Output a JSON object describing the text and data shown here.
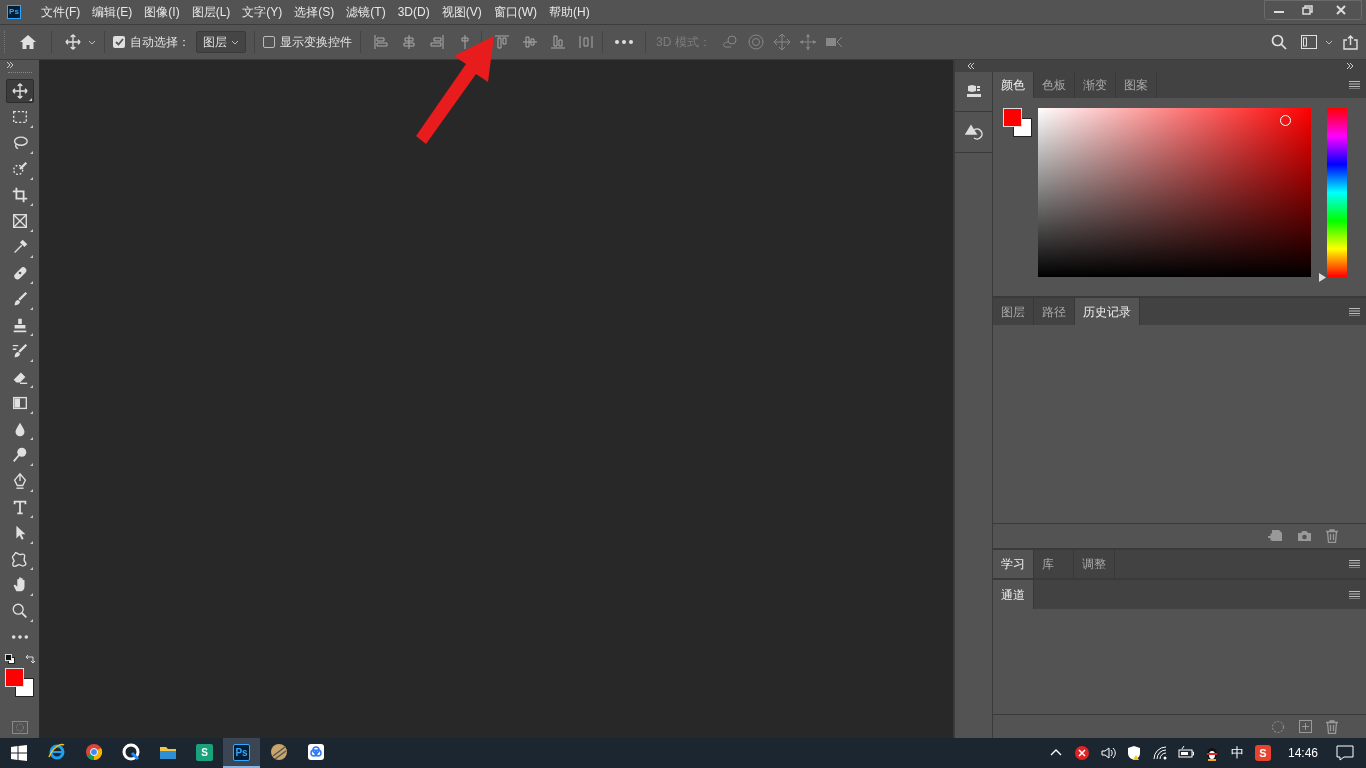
{
  "app_logo": "Ps",
  "menu": [
    "文件(F)",
    "编辑(E)",
    "图像(I)",
    "图层(L)",
    "文字(Y)",
    "选择(S)",
    "滤镜(T)",
    "3D(D)",
    "视图(V)",
    "窗口(W)",
    "帮助(H)"
  ],
  "options_bar": {
    "auto_select": {
      "label": "自动选择：",
      "checked": true
    },
    "target": {
      "value": "图层"
    },
    "show_transform": {
      "label": "显示变换控件",
      "checked": false
    },
    "mode_label": "3D 模式："
  },
  "tools": [
    {
      "kind": "move",
      "selected": true
    },
    {
      "kind": "marquee",
      "selected": false
    },
    {
      "kind": "lasso",
      "selected": false
    },
    {
      "kind": "quick",
      "selected": false
    },
    {
      "kind": "crop",
      "selected": false
    },
    {
      "kind": "frame",
      "selected": false
    },
    {
      "kind": "eyedropper",
      "selected": false
    },
    {
      "kind": "healing",
      "selected": false
    },
    {
      "kind": "brush",
      "selected": false
    },
    {
      "kind": "stamp",
      "selected": false
    },
    {
      "kind": "history",
      "selected": false
    },
    {
      "kind": "eraser",
      "selected": false
    },
    {
      "kind": "gradient",
      "selected": false
    },
    {
      "kind": "blur",
      "selected": false
    },
    {
      "kind": "dodge",
      "selected": false
    },
    {
      "kind": "pen",
      "selected": false
    },
    {
      "kind": "type",
      "selected": false
    },
    {
      "kind": "pathselect",
      "selected": false
    },
    {
      "kind": "shape",
      "selected": false
    },
    {
      "kind": "hand",
      "selected": false
    },
    {
      "kind": "zoom",
      "selected": false
    },
    {
      "kind": "more",
      "selected": false
    }
  ],
  "colors": [
    {
      "kind": "foreground",
      "color": "#ff0000"
    },
    {
      "kind": "background",
      "color": "#ffffff"
    }
  ],
  "color_panel": {
    "hue_slider": {
      "level": 0
    },
    "tabs": [
      {
        "label": "颜色",
        "selected": true
      },
      {
        "label": "色板",
        "selected": false
      },
      {
        "label": "渐变",
        "selected": false
      },
      {
        "label": "图案",
        "selected": false
      }
    ]
  },
  "history_panel": {
    "tabs": [
      {
        "label": "图层",
        "selected": false
      },
      {
        "label": "路径",
        "selected": false
      },
      {
        "label": "历史记录",
        "selected": true
      }
    ]
  },
  "learn_panel": {
    "tabs": [
      {
        "label": "学习",
        "selected": true
      },
      {
        "label": "库",
        "selected": false
      },
      {
        "label": "调整",
        "selected": false
      }
    ]
  },
  "channels_panel": {
    "tabs": [
      {
        "label": "通道",
        "selected": true
      }
    ]
  },
  "taskbar": {
    "apps": [
      {
        "kind": "ie",
        "active": false
      },
      {
        "kind": "chrome",
        "active": false
      },
      {
        "kind": "edge",
        "active": false
      },
      {
        "kind": "folder",
        "active": false
      },
      {
        "kind": "letter",
        "label": "S",
        "active": false
      },
      {
        "kind": "letter",
        "label": "Ps",
        "active": true
      },
      {
        "kind": "ball",
        "active": false
      },
      {
        "kind": "cloud",
        "active": false
      }
    ],
    "ime": "中",
    "sogou": "S",
    "time": "14:46"
  }
}
